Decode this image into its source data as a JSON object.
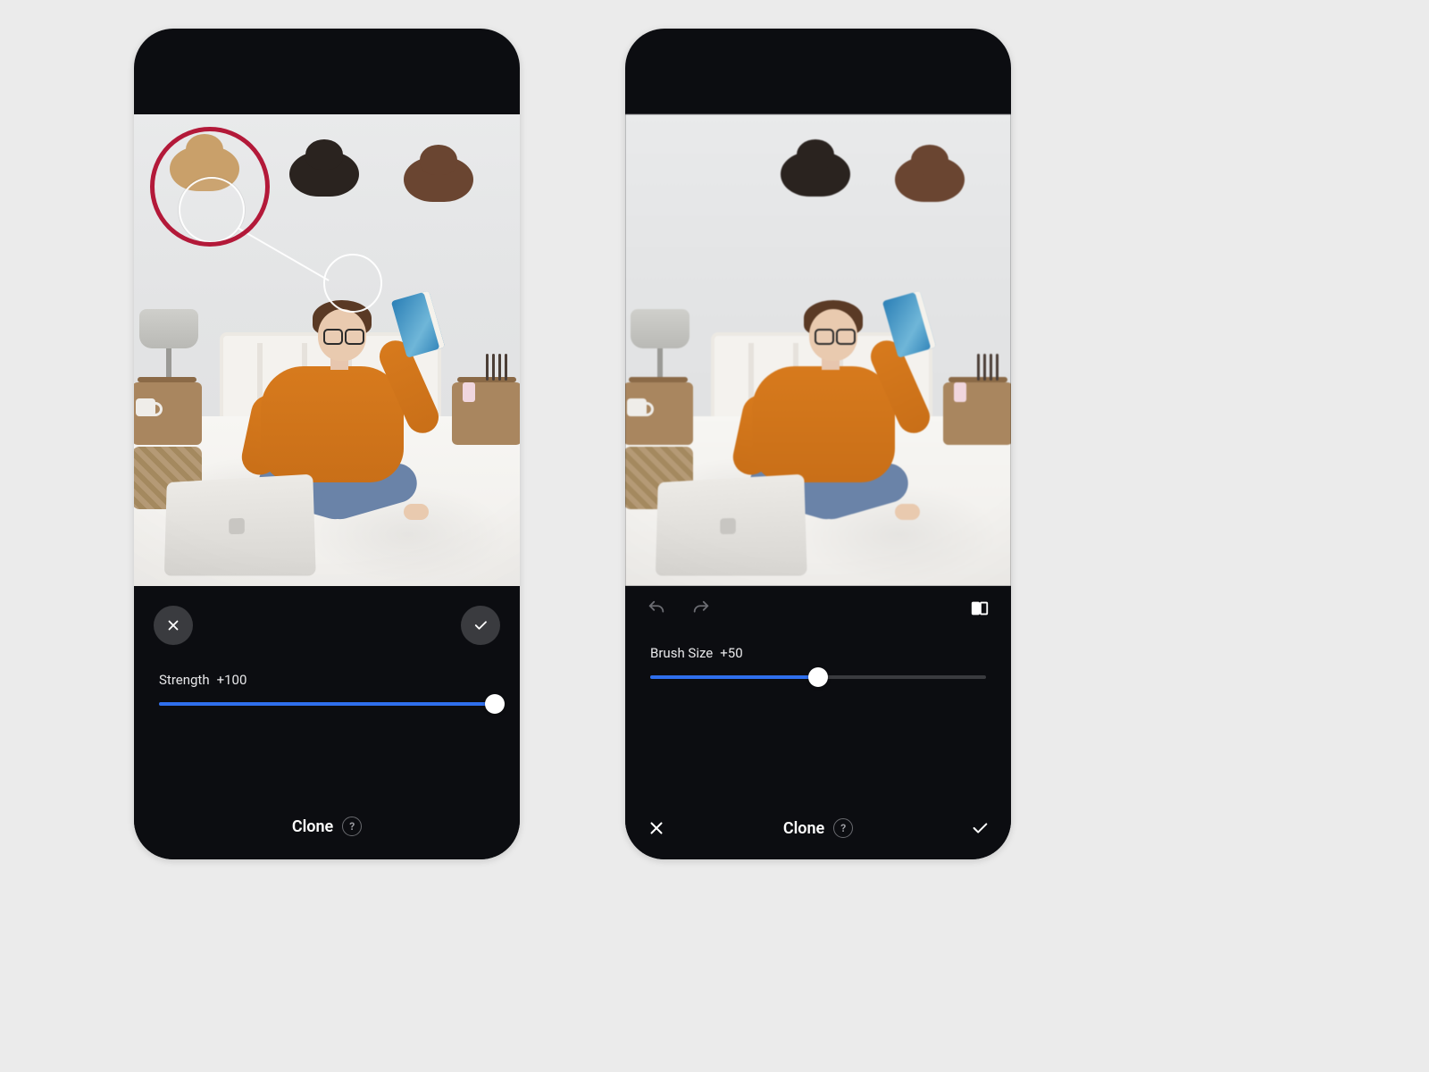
{
  "left": {
    "tool_name": "Clone",
    "help_symbol": "?",
    "slider": {
      "label": "Strength",
      "value_text": "+100",
      "percent": 100
    },
    "cancel_icon": "close-icon",
    "confirm_icon": "check-icon"
  },
  "right": {
    "tool_name": "Clone",
    "help_symbol": "?",
    "slider": {
      "label": "Brush Size",
      "value_text": "+50",
      "percent": 50
    },
    "toolbar": {
      "undo_icon": "undo-icon",
      "redo_icon": "redo-icon",
      "compare_icon": "compare-icon"
    },
    "cancel_icon": "close-icon",
    "confirm_icon": "check-icon"
  },
  "annotations": {
    "highlight": "clone-source-highlight",
    "clone_source": "clone-source-circle",
    "clone_target": "clone-target-circle",
    "clone_link": "clone-link-line"
  }
}
